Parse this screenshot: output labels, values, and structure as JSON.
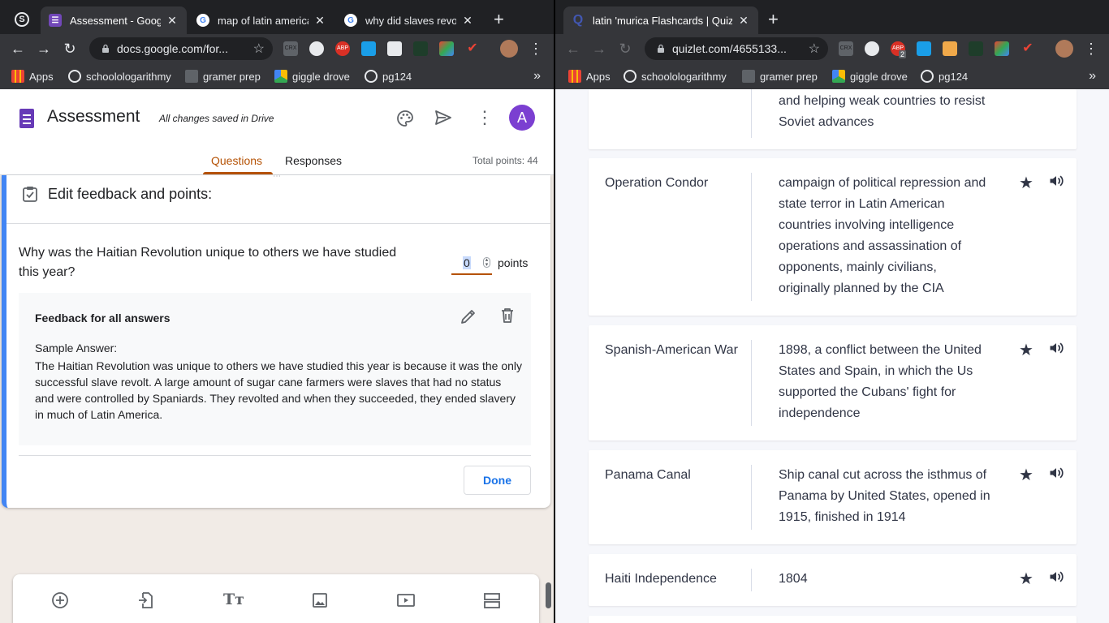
{
  "left": {
    "tabs": [
      {
        "title": "Assessment - Google",
        "active": true
      },
      {
        "title": "map of latin america",
        "active": false
      },
      {
        "title": "why did slaves revolt",
        "active": false
      }
    ],
    "url": "docs.google.com/for...",
    "bookmarks": [
      "Apps",
      "schoolologarithmy",
      "gramer prep",
      "giggle drove",
      "pg124"
    ],
    "form": {
      "title": "Assessment",
      "saved_status": "All changes saved in Drive",
      "avatar_letter": "A",
      "tab_questions": "Questions",
      "tab_responses": "Responses",
      "total_points": "Total points: 44",
      "edit_feedback_title": "Edit feedback and points:",
      "question": "Why was the Haitian Revolution unique to others we have studied this year?",
      "points_value": "0",
      "points_label": "points",
      "feedback_title": "Feedback for all answers",
      "sample_label": "Sample Answer:",
      "sample_text": "The Haitian Revolution was unique to others we have studied this year is because it was the only successful slave revolt. A large amount of sugar cane farmers were slaves that had no status and were controlled by Spaniards. They revolted and when they succeeded, they ended slavery in much of Latin America.",
      "done_label": "Done"
    },
    "accent": "#673ab7",
    "tab_accent": "#b55205"
  },
  "right": {
    "tabs": [
      {
        "title": "latin 'murica Flashcards | Quizl",
        "active": true
      }
    ],
    "url": "quizlet.com/4655133...",
    "bookmarks": [
      "Apps",
      "schoolologarithmy",
      "gramer prep",
      "giggle drove",
      "pg124"
    ],
    "ext_badge": "2",
    "partial_definition": "and helping weak countries to resist Soviet advances",
    "cards": [
      {
        "term": "Operation Condor",
        "definition": "campaign of political repression and state terror in Latin American countries involving intelligence operations and assassination of opponents, mainly civilians, originally planned by the CIA"
      },
      {
        "term": "Spanish-American War",
        "definition": "1898, a conflict between the United States and Spain, in which the Us supported the Cubans' fight for independence"
      },
      {
        "term": "Panama Canal",
        "definition": "Ship canal cut across the isthmus of Panama by United States, opened in 1915, finished in 1914"
      },
      {
        "term": "Haiti Independence",
        "definition": "1804"
      }
    ]
  }
}
